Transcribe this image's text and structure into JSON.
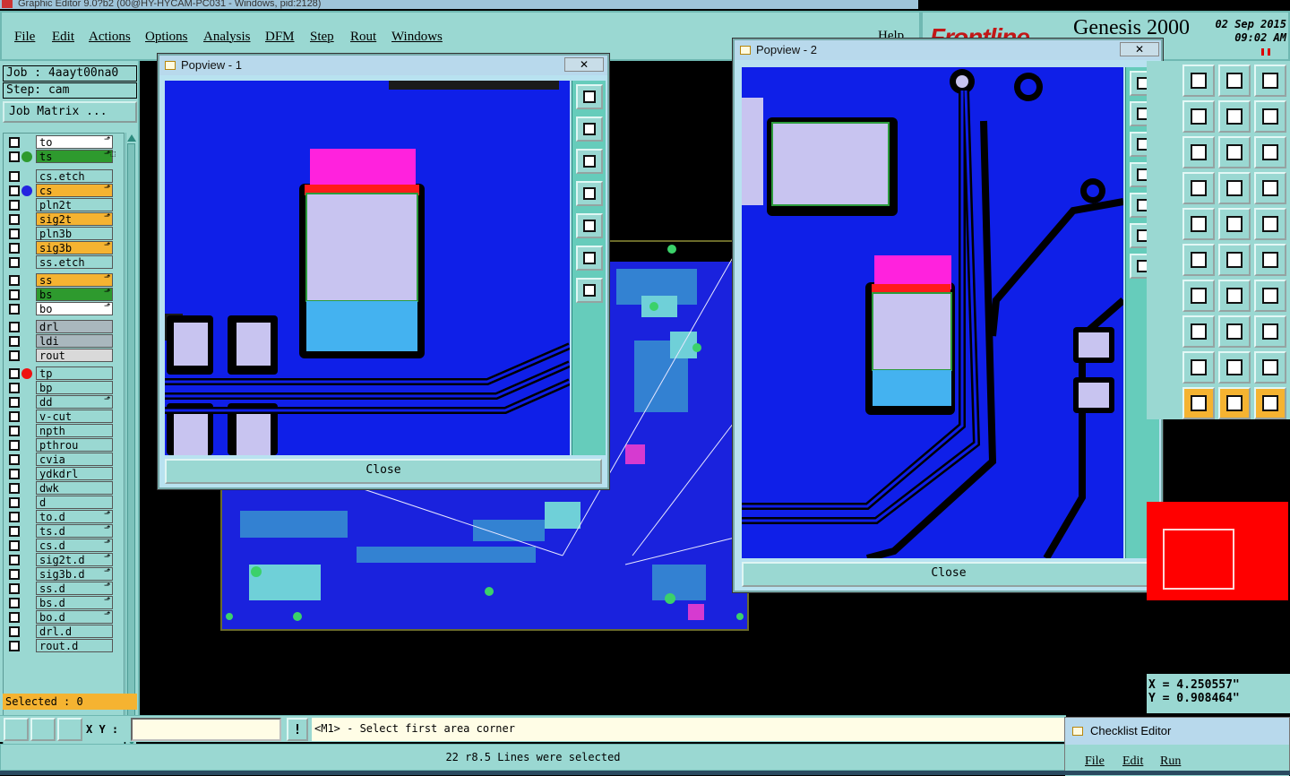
{
  "window": {
    "title": "Graphic Editor 9.0?b2 (00@HY-HYCAM-PC031 - Windows, pid:2128)"
  },
  "menu": [
    "File",
    "Edit",
    "Actions",
    "Options",
    "Analysis",
    "DFM",
    "Step",
    "Rout",
    "Windows"
  ],
  "menu_help": "Help",
  "brand": {
    "logo": "Frontline",
    "product": "Genesis 2000",
    "date": "02 Sep 2015",
    "time": "09:02 AM"
  },
  "job": {
    "job_label": "Job : 4aayt00na0",
    "step_label": "Step: cam",
    "job_matrix": "Job Matrix ..."
  },
  "layers": [
    {
      "name": "to",
      "color": "#ffffff",
      "dot": "",
      "mark": "⬏"
    },
    {
      "name": "ts",
      "color": "#2e9a2e",
      "dot": "#2e9a2e",
      "mark": "⬏⬚"
    },
    {
      "name": "cs.etch",
      "color": "#9ad8d2",
      "dot": "",
      "mark": ""
    },
    {
      "name": "cs",
      "color": "#f5b331",
      "dot": "#2424e0",
      "mark": "⬏"
    },
    {
      "name": "pln2t",
      "color": "#9ad8d2",
      "dot": "",
      "mark": ""
    },
    {
      "name": "sig2t",
      "color": "#f5b331",
      "dot": "",
      "mark": "⬏"
    },
    {
      "name": "pln3b",
      "color": "#9ad8d2",
      "dot": "",
      "mark": ""
    },
    {
      "name": "sig3b",
      "color": "#f5b331",
      "dot": "",
      "mark": "⬏"
    },
    {
      "name": "ss.etch",
      "color": "#9ad8d2",
      "dot": "",
      "mark": ""
    },
    {
      "name": "ss",
      "color": "#f5b331",
      "dot": "",
      "mark": "⬏"
    },
    {
      "name": "bs",
      "color": "#2e9a2e",
      "dot": "",
      "mark": "⬏"
    },
    {
      "name": "bo",
      "color": "#ffffff",
      "dot": "",
      "mark": "⬏"
    },
    {
      "name": "drl",
      "color": "#a9b7bd",
      "dot": "",
      "mark": ""
    },
    {
      "name": "ldi",
      "color": "#a9b7bd",
      "dot": "",
      "mark": ""
    },
    {
      "name": "rout",
      "color": "#d9d9d9",
      "dot": "",
      "mark": ""
    },
    {
      "name": "tp",
      "color": "#9ad8d2",
      "dot": "#ee1111",
      "mark": ""
    },
    {
      "name": "bp",
      "color": "#9ad8d2",
      "dot": "",
      "mark": ""
    },
    {
      "name": "dd",
      "color": "#9ad8d2",
      "dot": "",
      "mark": "⬏"
    },
    {
      "name": "v-cut",
      "color": "#9ad8d2",
      "dot": "",
      "mark": ""
    },
    {
      "name": "npth",
      "color": "#9ad8d2",
      "dot": "",
      "mark": ""
    },
    {
      "name": "pthrou",
      "color": "#9ad8d2",
      "dot": "",
      "mark": ""
    },
    {
      "name": "cvia",
      "color": "#9ad8d2",
      "dot": "",
      "mark": ""
    },
    {
      "name": "ydkdrl",
      "color": "#9ad8d2",
      "dot": "",
      "mark": ""
    },
    {
      "name": "dwk",
      "color": "#9ad8d2",
      "dot": "",
      "mark": ""
    },
    {
      "name": "d",
      "color": "#9ad8d2",
      "dot": "",
      "mark": ""
    },
    {
      "name": "to.d",
      "color": "#9ad8d2",
      "dot": "",
      "mark": "⬏"
    },
    {
      "name": "ts.d",
      "color": "#9ad8d2",
      "dot": "",
      "mark": "⬏"
    },
    {
      "name": "cs.d",
      "color": "#9ad8d2",
      "dot": "",
      "mark": "⬏"
    },
    {
      "name": "sig2t.d",
      "color": "#9ad8d2",
      "dot": "",
      "mark": "⬏"
    },
    {
      "name": "sig3b.d",
      "color": "#9ad8d2",
      "dot": "",
      "mark": "⬏"
    },
    {
      "name": "ss.d",
      "color": "#9ad8d2",
      "dot": "",
      "mark": "⬏"
    },
    {
      "name": "bs.d",
      "color": "#9ad8d2",
      "dot": "",
      "mark": "⬏"
    },
    {
      "name": "bo.d",
      "color": "#9ad8d2",
      "dot": "",
      "mark": "⬏"
    },
    {
      "name": "drl.d",
      "color": "#9ad8d2",
      "dot": "",
      "mark": ""
    },
    {
      "name": "rout.d",
      "color": "#9ad8d2",
      "dot": "",
      "mark": ""
    }
  ],
  "selected": "Selected : 0",
  "popview1": {
    "title": "Popview - 1",
    "close_x": "✕",
    "close": "Close"
  },
  "popview2": {
    "title": "Popview - 2",
    "close_x": "✕",
    "close": "Close"
  },
  "coords": {
    "x": "X = 4.250557\"",
    "y": "Y = 0.908464\""
  },
  "bottom": {
    "xy_label": "X Y :",
    "xy_value": "",
    "warn": "!",
    "prompt": "<M1> - Select first area corner",
    "status": "22 r8.5 Lines were selected"
  },
  "checklist": {
    "title": "Checklist Editor",
    "menu": [
      "File",
      "Edit",
      "Run"
    ]
  },
  "colors": {
    "panel": "#9ad8d2",
    "board": "#1a22dd",
    "highlight": "#f5b331"
  }
}
